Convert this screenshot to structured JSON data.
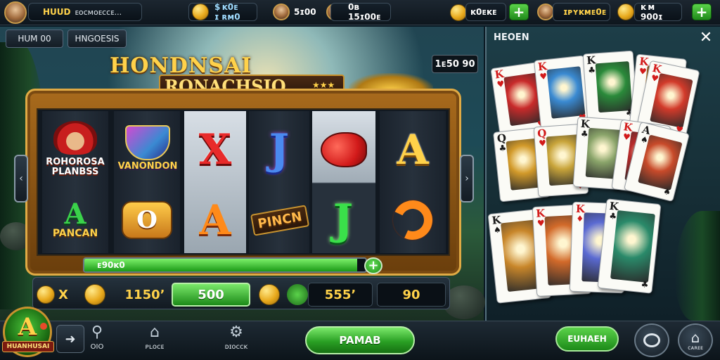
{
  "topbar": {
    "player_name": "HUUD",
    "player_sub": "ᴇᴏᴄᴍᴏᴇᴄᴄᴇ...",
    "currency1": "$ ᴋ0ᴇ ɪ ʀᴍ0",
    "stat1": "5ɪ00",
    "stat2": "0ʙ 15ɪ00ᴇ",
    "currency2": "ᴋ0ᴇᴋᴇ",
    "currency3": "ɪᴘʏᴋᴍᴇ0ᴇ",
    "currency4": "ᴋ ᴍ  900ɪ",
    "colors": {
      "plus_green": "#2a9a20",
      "gold": "#e8a91c"
    }
  },
  "tabs": [
    {
      "label": "HUM 00"
    },
    {
      "label": "HNGOESIS"
    }
  ],
  "title": {
    "line1": "HONDNSAI",
    "line2": "RONACHSIO",
    "stars": "★★★"
  },
  "top_counter": "1ᴇ50 90",
  "reels": [
    {
      "top": "ROHOROSA PLANBSS",
      "bottom": "PANCAN"
    },
    {
      "top": "VANONDON",
      "bottom": "O"
    },
    {
      "top": "X",
      "bottom": "A"
    },
    {
      "top": "J",
      "bottom": "PINCN"
    },
    {
      "top": "fish",
      "bottom": "J"
    },
    {
      "top": "A",
      "bottom": "arrow"
    }
  ],
  "progress": {
    "label": "ᴇ90ᴋ0",
    "fraction": 0.97
  },
  "bet_row": {
    "multiplier": "X",
    "coins_value": "1150’",
    "bet_button": "500",
    "win_value": "555’",
    "total_value": "90"
  },
  "card_panel": {
    "title": "HEOEN",
    "close_icon": "close-icon",
    "cards": [
      {
        "rank": "K",
        "suit": "♥",
        "color": "#d21a1a",
        "art": "#c82a2a"
      },
      {
        "rank": "K",
        "suit": "♥",
        "color": "#d21a1a",
        "art": "#3a8ad2"
      },
      {
        "rank": "K",
        "suit": "♣",
        "color": "#1a1a1a",
        "art": "#2a8a3a"
      },
      {
        "rank": "K",
        "suit": "♥",
        "color": "#d21a1a",
        "art": "#c8761a"
      },
      {
        "rank": "K",
        "suit": "♥",
        "color": "#d21a1a",
        "art": "#d23a2a"
      },
      {
        "rank": "Q",
        "suit": "♣",
        "color": "#1a1a1a",
        "art": "#d29a2a"
      },
      {
        "rank": "Q",
        "suit": "♥",
        "color": "#d21a1a",
        "art": "#c8a43a"
      },
      {
        "rank": "K",
        "suit": "♣",
        "color": "#1a1a1a",
        "art": "#8aa46a"
      },
      {
        "rank": "K",
        "suit": "♥",
        "color": "#d21a1a",
        "art": "#b82a2a"
      },
      {
        "rank": "A",
        "suit": "♠",
        "color": "#1a1a1a",
        "art": "#c84a2a"
      },
      {
        "rank": "K",
        "suit": "♠",
        "color": "#1a1a1a",
        "art": "#c8862a"
      },
      {
        "rank": "K",
        "suit": "♥",
        "color": "#d21a1a",
        "art": "#d26a2a"
      },
      {
        "rank": "K",
        "suit": "♦",
        "color": "#d21a1a",
        "art": "#5a6ad2"
      },
      {
        "rank": "K",
        "suit": "♣",
        "color": "#1a1a1a",
        "art": "#2a8a6a"
      }
    ]
  },
  "bottombar": {
    "logo_letter": "A",
    "logo_word": "HUANHUSAI",
    "nav": [
      {
        "icon": "search-icon",
        "glyph": "⚲",
        "label": "OIO"
      },
      {
        "icon": "home-icon",
        "glyph": "⌂",
        "label": "ᴘʟᴏᴄᴇ"
      },
      {
        "icon": "gear-icon",
        "glyph": "⚙",
        "label": "ᴅɪᴏᴄᴄᴋ"
      }
    ],
    "main_button": "PAMAB",
    "secondary_button": "EUHAEH",
    "chat_icon": "chat-icon",
    "home_label": "ᴄᴀʀᴇᴇ"
  }
}
